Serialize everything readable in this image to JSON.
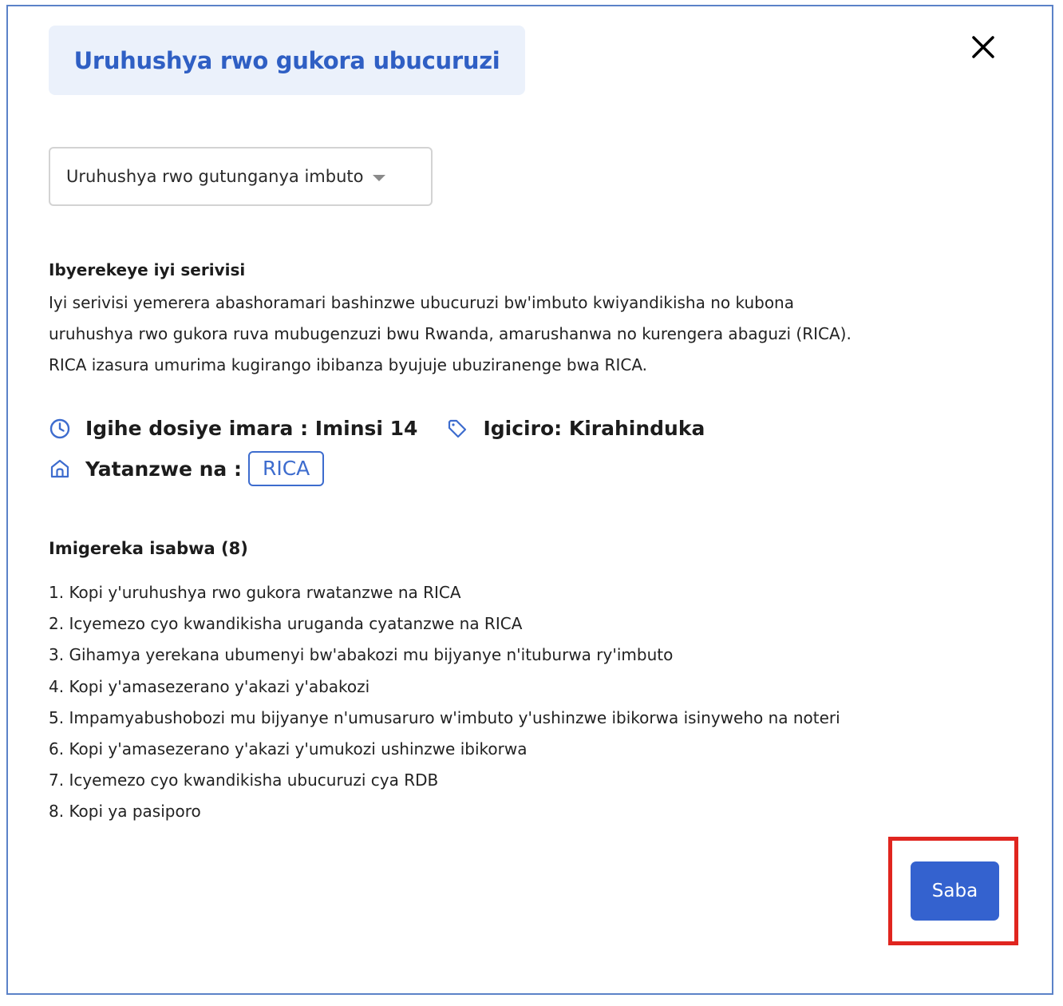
{
  "modal": {
    "title": "Uruhushya rwo gukora ubucuruzi",
    "close_icon": "close-icon"
  },
  "permit_select": {
    "selected": "Uruhushya rwo gutunganya imbuto",
    "icon": "chevron-down-icon"
  },
  "about": {
    "heading": "Ibyerekeye iyi serivisi",
    "lines": [
      "Iyi serivisi yemerera abashoramari bashinzwe ubucuruzi bw'imbuto kwiyandikisha no kubona",
      "uruhushya rwo gukora ruva mubugenzuzi bwu Rwanda, amarushanwa no kurengera abaguzi (RICA).",
      "RICA izasura umurima kugirango ibibanza byujuje ubuziranenge bwa RICA."
    ]
  },
  "meta": {
    "duration": "Igihe dosiye imara : Iminsi 14",
    "price": "Igiciro: Kirahinduka",
    "issued_by_label": "Yatanzwe na :",
    "issuer": "RICA",
    "icons": [
      "clock-icon",
      "tag-icon",
      "home-icon"
    ],
    "accent_color": "#3d6cce"
  },
  "documents": {
    "heading": "Imigereka isabwa (8)",
    "items": [
      "1. Kopi y'uruhushya rwo gukora rwatanzwe na RICA",
      "2. Icyemezo cyo kwandikisha uruganda cyatanzwe na RICA",
      "3. Gihamya yerekana ubumenyi bw'abakozi mu bijyanye n'ituburwa ry'imbuto",
      "4. Kopi y'amasezerano y'akazi y'abakozi",
      "5. Impamyabushobozi mu bijyanye n'umusaruro w'imbuto y'ushinzwe ibikorwa isinyweho na noteri",
      "6. Kopi y'amasezerano y'akazi y'umukozi ushinzwe ibikorwa",
      "7. Icyemezo cyo kwandikisha ubucuruzi cya RDB",
      "8. Kopi ya pasiporo"
    ]
  },
  "actions": {
    "apply_label": "Saba",
    "button_color": "#3462cf",
    "highlight_color": "#e0251f"
  }
}
